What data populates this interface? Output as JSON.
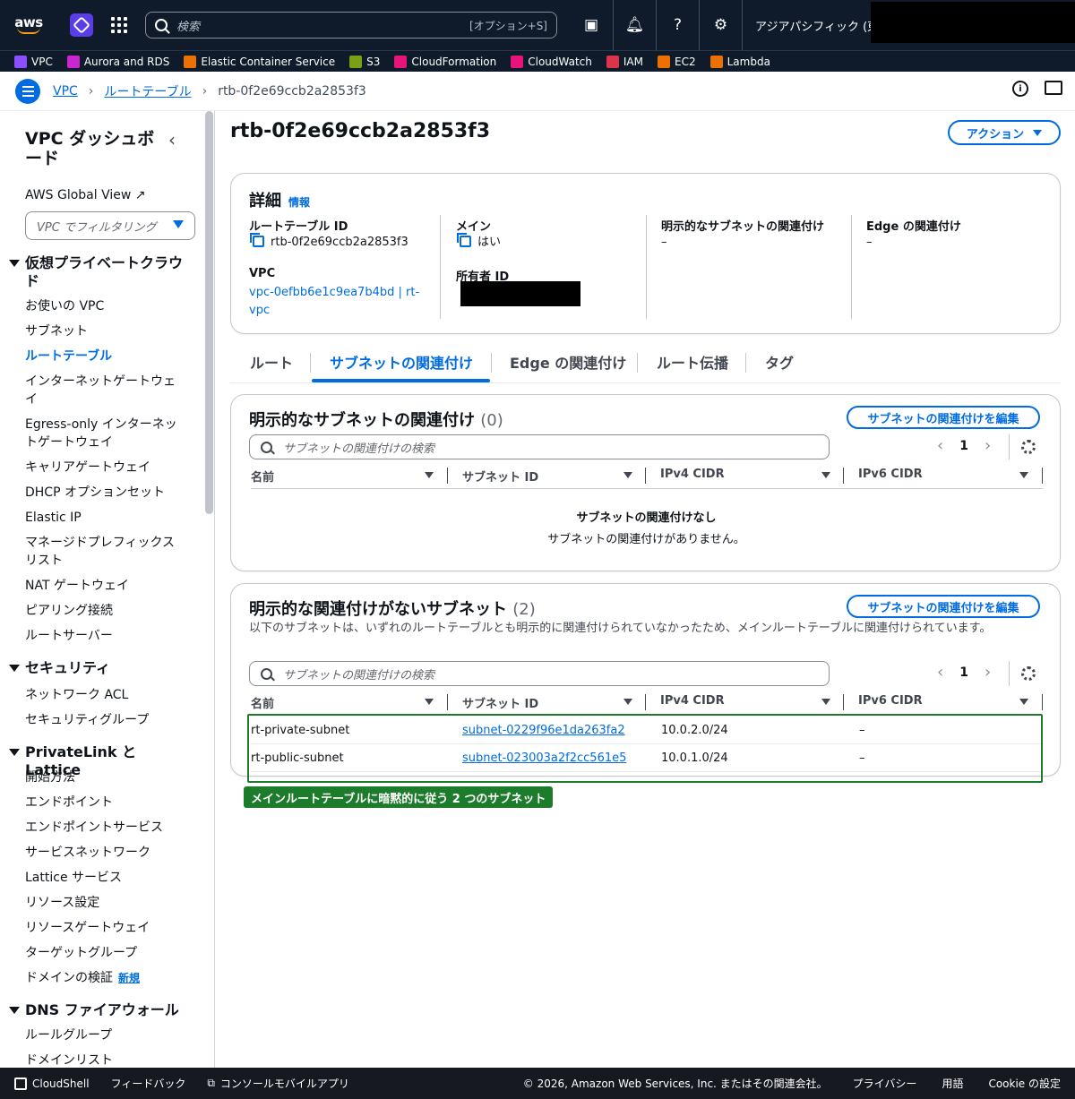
{
  "topbar": {
    "logo": "aws",
    "search_placeholder": "検索",
    "search_shortcut": "[オプション+S]",
    "region": "アジアパシフィック (東京)"
  },
  "favorites": [
    {
      "label": "VPC",
      "color": "#8c4fff"
    },
    {
      "label": "Aurora and RDS",
      "color": "#c925d1"
    },
    {
      "label": "Elastic Container Service",
      "color": "#ed7100"
    },
    {
      "label": "S3",
      "color": "#7aa116"
    },
    {
      "label": "CloudFormation",
      "color": "#e7157b"
    },
    {
      "label": "CloudWatch",
      "color": "#e7157b"
    },
    {
      "label": "IAM",
      "color": "#dd344c"
    },
    {
      "label": "EC2",
      "color": "#ed7100"
    },
    {
      "label": "Lambda",
      "color": "#ed7100"
    }
  ],
  "breadcrumb": {
    "items": [
      "VPC",
      "ルートテーブル"
    ],
    "current": "rtb-0f2e69ccb2a2853f3"
  },
  "sidebar": {
    "title": "VPC ダッシュボード",
    "global_view": "AWS Global View",
    "filter_placeholder": "VPC でフィルタリング",
    "sections": [
      {
        "title": "仮想プライベートクラウド"
      },
      {
        "title": "セキュリティ"
      },
      {
        "title": "PrivateLink と Lattice"
      },
      {
        "title": "DNS ファイアウォール"
      }
    ],
    "items": {
      "vpc": "お使いの VPC",
      "subnet": "サブネット",
      "route_table": "ルートテーブル",
      "igw": "インターネットゲートウェイ",
      "egress": "Egress-only インターネットゲートウェイ",
      "carrier": "キャリアゲートウェイ",
      "dhcp": "DHCP オプションセット",
      "eip": "Elastic IP",
      "prefix": "マネージドプレフィックスリスト",
      "nat": "NAT ゲートウェイ",
      "peering": "ピアリング接続",
      "route_server": "ルートサーバー",
      "acl": "ネットワーク ACL",
      "sg": "セキュリティグループ",
      "getting_started": "開始方法",
      "endpoint": "エンドポイント",
      "endpoint_service": "エンドポイントサービス",
      "service_network": "サービスネットワーク",
      "lattice_service": "Lattice サービス",
      "resource_config": "リソース設定",
      "resource_gw": "リソースゲートウェイ",
      "target_group": "ターゲットグループ",
      "domain_verify": "ドメインの検証",
      "domain_verify_badge": "新規",
      "rule_group": "ルールグループ",
      "domain_list": "ドメインリスト"
    }
  },
  "page": {
    "title": "rtb-0f2e69ccb2a2853f3",
    "action_button": "アクション"
  },
  "details": {
    "heading": "詳細",
    "info": "情報",
    "route_table_id_label": "ルートテーブル ID",
    "route_table_id": "rtb-0f2e69ccb2a2853f3",
    "main_label": "メイン",
    "main_value": "はい",
    "explicit_label": "明示的なサブネットの関連付け",
    "explicit_value": "–",
    "edge_label": "Edge の関連付け",
    "edge_value": "–",
    "vpc_label": "VPC",
    "vpc_value": "vpc-0efbb6e1c9ea7b4bd | rt-vpc",
    "owner_label": "所有者 ID"
  },
  "tabs": [
    "ルート",
    "サブネットの関連付け",
    "Edge の関連付け",
    "ルート伝播",
    "タグ"
  ],
  "explicit_table": {
    "heading": "明示的なサブネットの関連付け",
    "count": "(0)",
    "edit_button": "サブネットの関連付けを編集",
    "search_placeholder": "サブネットの関連付けの検索",
    "page": "1",
    "columns": [
      "名前",
      "サブネット ID",
      "IPv4 CIDR",
      "IPv6 CIDR"
    ],
    "empty_title": "サブネットの関連付けなし",
    "empty_sub": "サブネットの関連付けがありません。"
  },
  "implicit_table": {
    "heading": "明示的な関連付けがないサブネット",
    "count": "(2)",
    "edit_button": "サブネットの関連付けを編集",
    "description": "以下のサブネットは、いずれのルートテーブルとも明示的に関連付けられていなかったため、メインルートテーブルに関連付けられています。",
    "search_placeholder": "サブネットの関連付けの検索",
    "page": "1",
    "columns": [
      "名前",
      "サブネット ID",
      "IPv4 CIDR",
      "IPv6 CIDR"
    ],
    "rows": [
      {
        "name": "rt-private-subnet",
        "subnet_id": "subnet-0229f96e1da263fa2",
        "ipv4": "10.0.2.0/24",
        "ipv6": "–"
      },
      {
        "name": "rt-public-subnet",
        "subnet_id": "subnet-023003a2f2cc561e5",
        "ipv4": "10.0.1.0/24",
        "ipv6": "–"
      }
    ]
  },
  "annotation": {
    "label": "メインルートテーブルに暗黙的に従う 2 つのサブネット",
    "color": "#1d7c2b"
  },
  "footer": {
    "cloudshell": "CloudShell",
    "feedback": "フィードバック",
    "mobile_app": "コンソールモバイルアプリ",
    "copyright": "© 2026, Amazon Web Services, Inc. またはその関連会社。",
    "privacy": "プライバシー",
    "terms": "用語",
    "cookie": "Cookie の設定"
  }
}
